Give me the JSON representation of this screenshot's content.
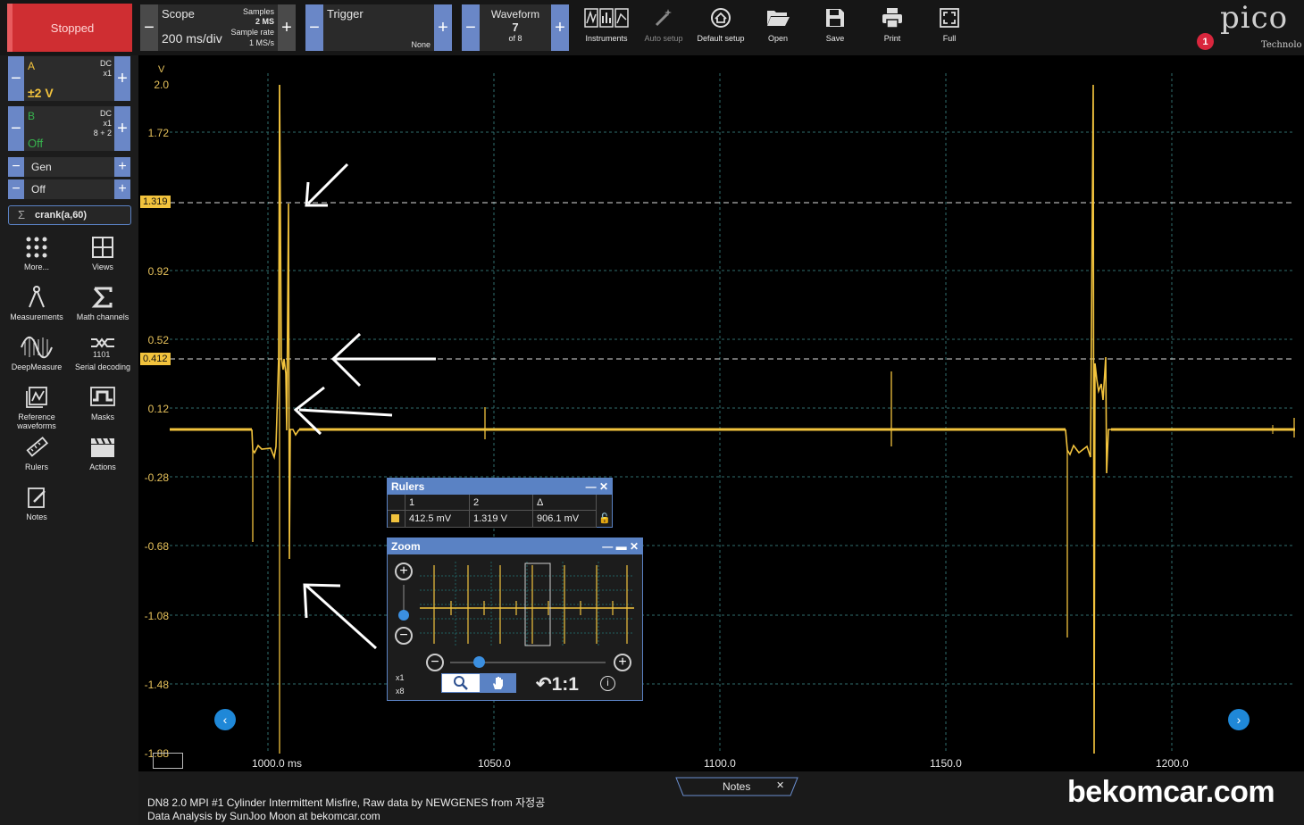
{
  "toolbar": {
    "run_state": "Stopped",
    "scope_label": "Scope",
    "timebase": "200 ms/div",
    "samples_label": "Samples",
    "samples_value": "2 MS",
    "sample_rate_label": "Sample rate",
    "sample_rate_value": "1 MS/s",
    "trigger_label": "Trigger",
    "trigger_mode": "None",
    "waveform_label": "Waveform",
    "waveform_index": "7",
    "waveform_total": "of 8",
    "tools": [
      "Instruments",
      "Auto setup",
      "Default setup",
      "Open",
      "Save",
      "Print",
      "Full"
    ],
    "brand_text": "pico",
    "brand_sub": "Technolo",
    "notification_count": "1"
  },
  "channels": {
    "a": {
      "name": "A",
      "coupling": "DC",
      "probe": "x1",
      "range": "±2 V"
    },
    "b": {
      "name": "B",
      "coupling": "DC",
      "probe": "x1",
      "resolution": "8 + 2",
      "range": "Off"
    },
    "gen": {
      "label": "Gen",
      "state": "Off"
    },
    "math": {
      "label": "crank(a,60)"
    }
  },
  "sidebar_tools": [
    {
      "label": "More..."
    },
    {
      "label": "Views"
    },
    {
      "label": "Measurements"
    },
    {
      "label": "Math channels"
    },
    {
      "label": "DeepMeasure"
    },
    {
      "label": "Serial decoding"
    },
    {
      "label": "Reference waveforms"
    },
    {
      "label": "Masks"
    },
    {
      "label": "Rulers"
    },
    {
      "label": "Actions"
    },
    {
      "label": "Notes"
    }
  ],
  "scope": {
    "y_unit": "V",
    "y_ticks": [
      "2.0",
      "1.72",
      "1.319",
      "0.92",
      "0.52",
      "0.412",
      "0.12",
      "-0.28",
      "-0.68",
      "-1.08",
      "-1.48",
      "-1.88"
    ],
    "x_ticks": [
      "1000.0 ms",
      "1050.0",
      "1100.0",
      "1150.0",
      "1200.0"
    ],
    "ruler_1_value": "1.319",
    "ruler_2_value": "0.412",
    "trace_color": "#f2c33d"
  },
  "rulers_window": {
    "title": "Rulers",
    "headers": [
      "1",
      "2",
      "Δ"
    ],
    "values": [
      "412.5 mV",
      "1.319 V",
      "906.1 mV"
    ]
  },
  "zoom_window": {
    "title": "Zoom",
    "zoom_x": "x1",
    "zoom_y": "x8",
    "reset_label": "1:1"
  },
  "notes_tab": "Notes",
  "footer": {
    "line1": "DN8 2.0 MPI #1 Cylinder Intermittent Misfire, Raw data by NEWGENES from 자정공",
    "line2": "Data Analysis by SunJoo Moon at bekomcar.com",
    "watermark": "bekomcar.com"
  }
}
